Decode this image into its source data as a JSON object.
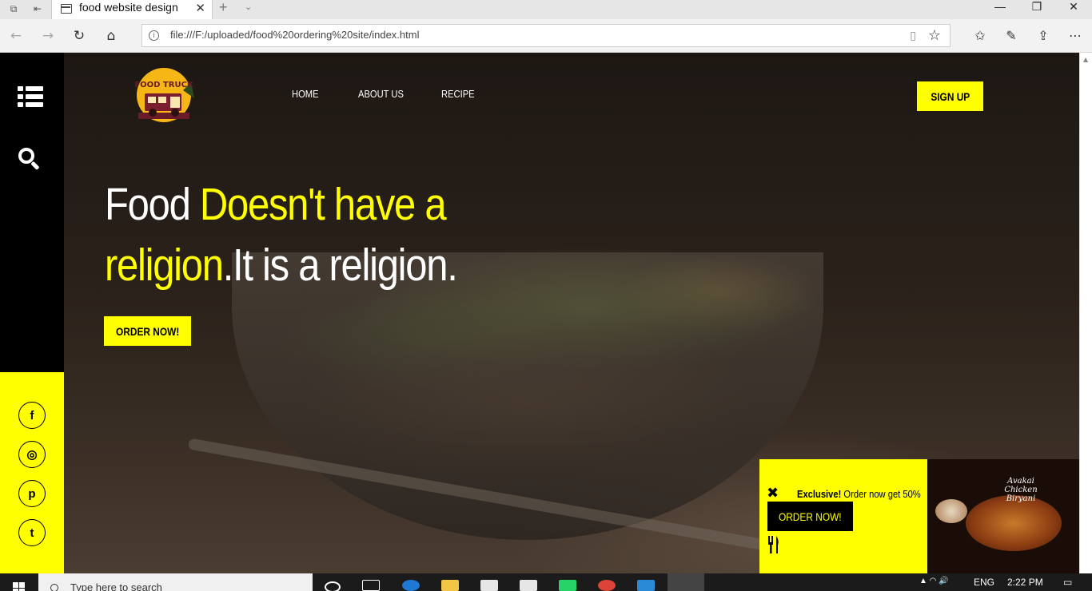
{
  "browser": {
    "tab_title": "food website design",
    "tab_close": "✕",
    "new_tab": "+",
    "url": "file:///F:/uploaded/food%20ordering%20site/index.html",
    "window_buttons": [
      "—",
      "❐",
      "✕"
    ]
  },
  "site": {
    "logo_text": "FOOD TRUCK",
    "nav": [
      "HOME",
      "ABOUT US",
      "RECIPE"
    ],
    "signup_label": "SIGN UP",
    "headline": {
      "line1_white": "Food ",
      "line1_yellow": "Doesn't have a",
      "line2_yellow": "religion",
      "line2_white": ".It is a religion."
    },
    "order_label": "ORDER NOW!",
    "social": [
      "f",
      "◎",
      "p",
      "t"
    ],
    "promo": {
      "exclusive": "Exclusive!",
      "text": " Order now get 50%",
      "button": "ORDER NOW!",
      "image_caption": "Avakai Chicken Biryani"
    }
  },
  "taskbar": {
    "search_placeholder": "Type here to search",
    "language": "ENG",
    "time": "2:22 PM"
  },
  "colors": {
    "accent": "#ffff00",
    "sidebar": "#000000"
  }
}
